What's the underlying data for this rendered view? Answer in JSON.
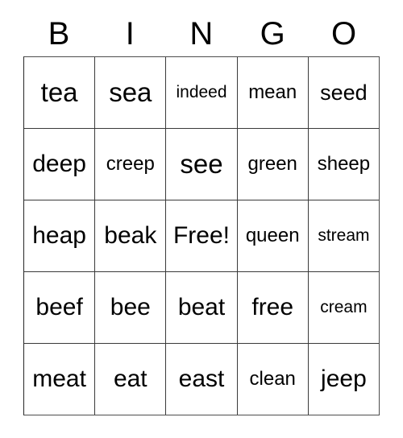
{
  "card": {
    "title": "BINGO",
    "header_letters": [
      "B",
      "I",
      "N",
      "G",
      "O"
    ],
    "free_space_label": "Free!",
    "free_space_position": {
      "row": 3,
      "column": 3
    },
    "grid_size": "5x5",
    "colors": {
      "background": "#ffffff",
      "text": "#000000",
      "grid_line": "#3a3a3a",
      "border": "#4d4d4d"
    },
    "rows": [
      {
        "cells": [
          {
            "text": "tea",
            "size": "fs-xl"
          },
          {
            "text": "sea",
            "size": "fs-xl"
          },
          {
            "text": "indeed",
            "size": "fs-xs"
          },
          {
            "text": "mean",
            "size": "fs-sm"
          },
          {
            "text": "seed",
            "size": "fs-md"
          }
        ]
      },
      {
        "cells": [
          {
            "text": "deep",
            "size": "fs-lg"
          },
          {
            "text": "creep",
            "size": "fs-sm"
          },
          {
            "text": "see",
            "size": "fs-xl"
          },
          {
            "text": "green",
            "size": "fs-sm"
          },
          {
            "text": "sheep",
            "size": "fs-sm"
          }
        ]
      },
      {
        "cells": [
          {
            "text": "heap",
            "size": "fs-lg"
          },
          {
            "text": "beak",
            "size": "fs-lg"
          },
          {
            "text": "Free!",
            "size": "fs-lg"
          },
          {
            "text": "queen",
            "size": "fs-sm"
          },
          {
            "text": "stream",
            "size": "fs-xs"
          }
        ]
      },
      {
        "cells": [
          {
            "text": "beef",
            "size": "fs-lg"
          },
          {
            "text": "bee",
            "size": "fs-lg"
          },
          {
            "text": "beat",
            "size": "fs-lg"
          },
          {
            "text": "free",
            "size": "fs-lg"
          },
          {
            "text": "cream",
            "size": "fs-xs"
          }
        ]
      },
      {
        "cells": [
          {
            "text": "meat",
            "size": "fs-lg"
          },
          {
            "text": "eat",
            "size": "fs-lg"
          },
          {
            "text": "east",
            "size": "fs-lg"
          },
          {
            "text": "clean",
            "size": "fs-sm"
          },
          {
            "text": "jeep",
            "size": "fs-lg"
          }
        ]
      }
    ]
  }
}
